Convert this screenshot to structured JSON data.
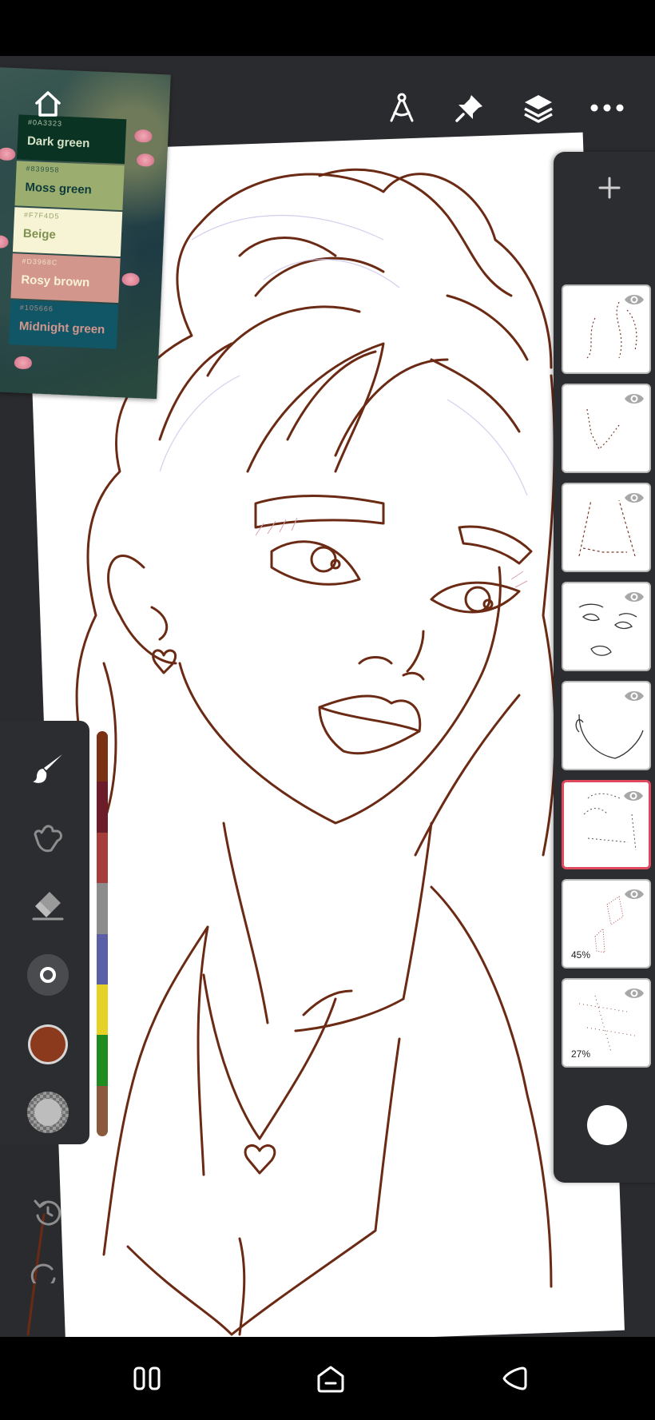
{
  "reference_palette": {
    "swatches": [
      {
        "hex": "#0A3323",
        "name": "Dark green",
        "color": "#0A3323",
        "text_color": "#D7E3C6"
      },
      {
        "hex": "#839958",
        "name": "Moss green",
        "color": "#9BAE70",
        "text_color": "#0E3B3A"
      },
      {
        "hex": "#F7F4D5",
        "name": "Beige",
        "color": "#F7F4D5",
        "text_color": "#7E9150"
      },
      {
        "hex": "#D3968C",
        "name": "Rosy brown",
        "color": "#D3968C",
        "text_color": "#F7F4D5"
      },
      {
        "hex": "#105666",
        "name": "Midnight green",
        "color": "#105666",
        "text_color": "#D3968C"
      }
    ]
  },
  "toolbar": {
    "icons": [
      "compass-icon",
      "pin-icon",
      "layers-icon",
      "more-icon"
    ]
  },
  "layers": {
    "items": [
      {
        "percent": "",
        "selected": false
      },
      {
        "percent": "",
        "selected": false
      },
      {
        "percent": "",
        "selected": false
      },
      {
        "percent": "",
        "selected": false
      },
      {
        "percent": "",
        "selected": false
      },
      {
        "percent": "",
        "selected": true
      },
      {
        "percent": "45%",
        "selected": false
      },
      {
        "percent": "27%",
        "selected": false
      }
    ],
    "layer_color": "#FFFFFF"
  },
  "tools": {
    "active_color": "#8B3A1E",
    "palette": [
      "#7A3212",
      "#6B1D2A",
      "#A63D3D",
      "#8C8C8C",
      "#5A5FA8",
      "#E6D224",
      "#1E8C1E",
      "#8B5A3C"
    ]
  },
  "colors": {
    "line_art": "#6B2A14",
    "panel": "#2C2D30",
    "selection": "#E0485E"
  }
}
